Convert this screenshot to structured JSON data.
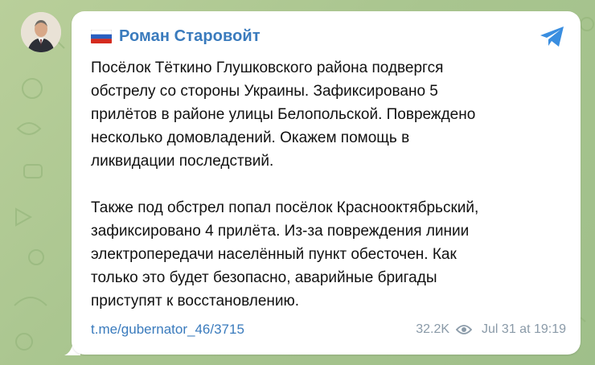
{
  "channel": {
    "author_name": "Роман Старовойт",
    "flag_icon": "russia-flag-icon",
    "avatar_icon": "avatar-photo",
    "share_icon": "telegram-share-icon"
  },
  "post": {
    "paragraphs": [
      [
        "Посёлок Тёткино Глушковского района подвергся",
        "обстрелу со стороны Украины. Зафиксировано 5",
        "прилётов в районе улицы Белопольской. Повреждено",
        "несколько домовладений. Окажем помощь в",
        "ликвидации последствий."
      ],
      [
        "Также под обстрел попал посёлок Краснооктябрьский,",
        "зафиксировано 4 прилёта. Из-за повреждения линии",
        "электропередачи населённый пункт обесточен. Как",
        "только это будет безопасно, аварийные бригады",
        "приступят к восстановлению."
      ]
    ],
    "link": "t.me/gubernator_46/3715",
    "views": "32.2K",
    "views_icon": "eye-icon",
    "timestamp": "Jul 31 at 19:19"
  },
  "colors": {
    "accent": "#3a7bbd",
    "background": "#a9c58f",
    "bubble": "#ffffff",
    "meta": "#8a9aa8"
  }
}
